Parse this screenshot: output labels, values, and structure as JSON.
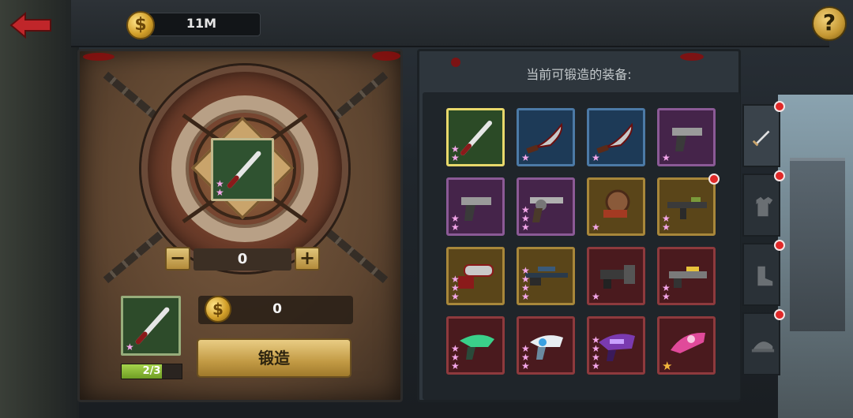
{
  "topbar": {
    "back_icon": "arrow-left-icon",
    "coin_symbol": "$",
    "coins": "11M",
    "help_label": "?"
  },
  "forge": {
    "target_stars": 2,
    "quantity": "0",
    "minus_label": "−",
    "plus_label": "+",
    "material_stars": 1,
    "material_progress": "2/3",
    "material_progress_value": 0.667,
    "cost_symbol": "$",
    "cost": "0",
    "forge_label": "锻造"
  },
  "equipment": {
    "title": "当前可锻造的装备:",
    "items": [
      {
        "name": "baseball-bat",
        "rarity": "green",
        "stars": 2,
        "selected": true,
        "dot": false
      },
      {
        "name": "machete",
        "rarity": "blue",
        "stars": 1,
        "selected": false,
        "dot": false
      },
      {
        "name": "machete",
        "rarity": "blue",
        "stars": 1,
        "selected": false,
        "dot": false
      },
      {
        "name": "pistol",
        "rarity": "purple",
        "stars": 1,
        "selected": false,
        "dot": false
      },
      {
        "name": "pistol",
        "rarity": "purple",
        "stars": 2,
        "selected": false,
        "dot": false
      },
      {
        "name": "revolver",
        "rarity": "purple",
        "stars": 3,
        "selected": false,
        "dot": false
      },
      {
        "name": "saw-launcher",
        "rarity": "gold",
        "stars": 1,
        "selected": false,
        "dot": false
      },
      {
        "name": "assault-rifle",
        "rarity": "gold",
        "stars": 2,
        "selected": false,
        "dot": true
      },
      {
        "name": "chainsaw",
        "rarity": "gold",
        "stars": 3,
        "selected": false,
        "dot": false
      },
      {
        "name": "sniper-rifle",
        "rarity": "gold",
        "stars": 4,
        "selected": false,
        "dot": false
      },
      {
        "name": "minigun",
        "rarity": "red",
        "stars": 1,
        "selected": false,
        "dot": false
      },
      {
        "name": "laser-rifle",
        "rarity": "red",
        "stars": 2,
        "selected": false,
        "dot": false
      },
      {
        "name": "plasma-pistol",
        "rarity": "red",
        "stars": 3,
        "selected": false,
        "dot": false
      },
      {
        "name": "ice-blaster",
        "rarity": "red",
        "stars": 3,
        "selected": false,
        "dot": false
      },
      {
        "name": "plasma-cannon",
        "rarity": "red",
        "stars": 4,
        "selected": false,
        "dot": false
      },
      {
        "name": "pink-blaster",
        "rarity": "red",
        "stars": 1,
        "gold_star": true,
        "selected": false,
        "dot": false
      }
    ]
  },
  "tabs": [
    {
      "name": "tab-weapons",
      "icon": "sword-icon",
      "active": true,
      "dot": true
    },
    {
      "name": "tab-armor",
      "icon": "shirt-icon",
      "active": false,
      "dot": true
    },
    {
      "name": "tab-boots",
      "icon": "boot-icon",
      "active": false,
      "dot": true
    },
    {
      "name": "tab-helmet",
      "icon": "cap-icon",
      "active": false,
      "dot": true
    }
  ],
  "colors": {
    "green": "#2b4a26",
    "blue": "#1d3a57",
    "purple": "#45244a",
    "gold": "#5a4519",
    "red": "#4a1a1e",
    "star": "#f4a7ea",
    "notification": "#e02828"
  }
}
